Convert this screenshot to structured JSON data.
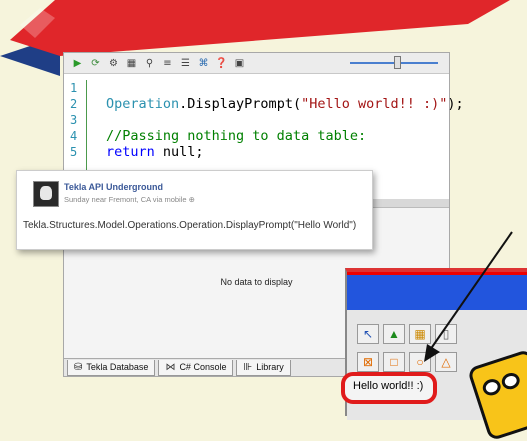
{
  "editor": {
    "toolbar": {
      "icons": [
        "run-icon",
        "refresh-icon",
        "settings-icon",
        "table-icon",
        "link-icon",
        "align-left-icon",
        "align-right-icon",
        "script-icon",
        "help-icon",
        "save-icon"
      ]
    },
    "line_numbers": [
      "1",
      "2",
      "3",
      "4",
      "5"
    ],
    "code": {
      "line2": {
        "cls": "Operation",
        "rest": ".DisplayPrompt(",
        "str": "\"Hello world!! :)\"",
        "end": ");"
      },
      "line4": "//Passing nothing to data table:",
      "line5": {
        "kw": "return",
        "rest": " null;"
      }
    },
    "grid": {
      "empty_text": "No data to display"
    },
    "tabs": [
      {
        "label": "Tekla Database",
        "icon": "database-icon"
      },
      {
        "label": "C# Console",
        "icon": "visual-studio-icon"
      },
      {
        "label": "Library",
        "icon": "library-icon"
      }
    ]
  },
  "card": {
    "name": "Tekla API Underground",
    "sub": "Sunday near Fremont, CA via mobile",
    "text": "Tekla.Structures.Model.Operations.Operation.DisplayPrompt(\"Hello World\")"
  },
  "inset": {
    "status_text": "Hello world!! :)"
  },
  "colors": {
    "ribbon_red": "#e0262a",
    "ribbon_blue": "#1f3e86",
    "accent_green": "#2f7d2a"
  }
}
